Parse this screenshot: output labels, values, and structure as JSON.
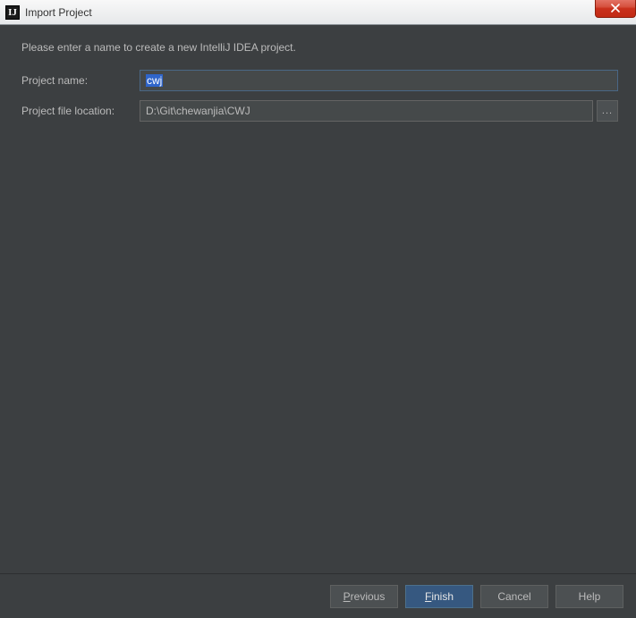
{
  "titlebar": {
    "icon_text": "IJ",
    "title": "Import Project"
  },
  "content": {
    "instruction": "Please enter a name to create a new IntelliJ IDEA project.",
    "project_name_label": "Project name:",
    "project_name_value": "cwj",
    "project_location_label": "Project file location:",
    "project_location_value": "D:\\Git\\chewanjia\\CWJ",
    "browse_label": "..."
  },
  "buttons": {
    "previous_pre": "P",
    "previous_rest": "revious",
    "finish_pre": "F",
    "finish_rest": "inish",
    "cancel": "Cancel",
    "help": "Help"
  }
}
